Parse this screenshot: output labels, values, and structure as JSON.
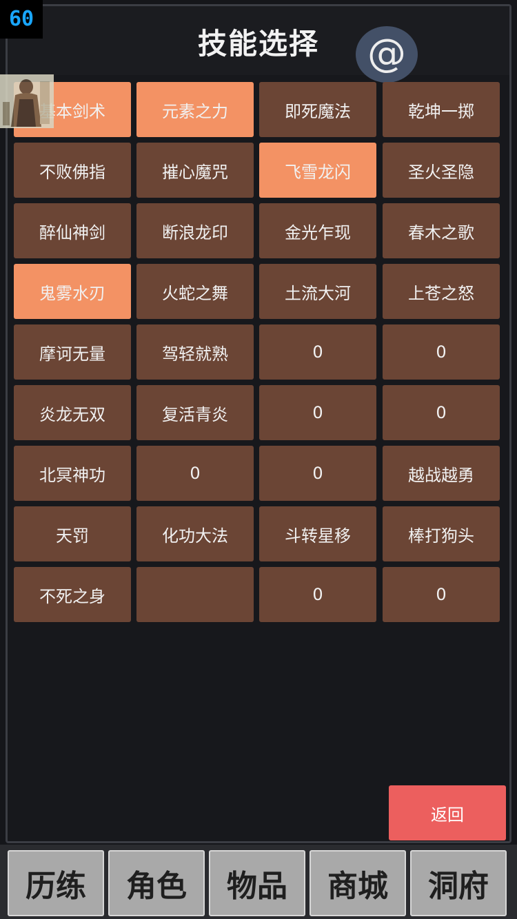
{
  "fps": "60",
  "header": {
    "title": "技能选择",
    "at_label": "@"
  },
  "skills": [
    {
      "label": "基本剑术",
      "selected": true
    },
    {
      "label": "元素之力",
      "selected": true
    },
    {
      "label": "即死魔法",
      "selected": false
    },
    {
      "label": "乾坤一掷",
      "selected": false
    },
    {
      "label": "不败佛指",
      "selected": false
    },
    {
      "label": "摧心魔咒",
      "selected": false
    },
    {
      "label": "飞雪龙闪",
      "selected": true
    },
    {
      "label": "圣火圣隐",
      "selected": false
    },
    {
      "label": "醉仙神剑",
      "selected": false
    },
    {
      "label": "断浪龙印",
      "selected": false
    },
    {
      "label": "金光乍现",
      "selected": false
    },
    {
      "label": "春木之歌",
      "selected": false
    },
    {
      "label": "鬼雾水刃",
      "selected": true
    },
    {
      "label": "火蛇之舞",
      "selected": false
    },
    {
      "label": "土流大河",
      "selected": false
    },
    {
      "label": "上苍之怒",
      "selected": false
    },
    {
      "label": "摩诃无量",
      "selected": false
    },
    {
      "label": "驾轻就熟",
      "selected": false
    },
    {
      "label": "0",
      "selected": false
    },
    {
      "label": "0",
      "selected": false
    },
    {
      "label": "炎龙无双",
      "selected": false
    },
    {
      "label": "复活青炎",
      "selected": false
    },
    {
      "label": "0",
      "selected": false
    },
    {
      "label": "0",
      "selected": false
    },
    {
      "label": "北冥神功",
      "selected": false
    },
    {
      "label": "0",
      "selected": false
    },
    {
      "label": "0",
      "selected": false
    },
    {
      "label": "越战越勇",
      "selected": false
    },
    {
      "label": "天罚",
      "selected": false
    },
    {
      "label": "化功大法",
      "selected": false
    },
    {
      "label": "斗转星移",
      "selected": false
    },
    {
      "label": "棒打狗头",
      "selected": false
    },
    {
      "label": "不死之身",
      "selected": false
    },
    {
      "label": "",
      "selected": false
    },
    {
      "label": "0",
      "selected": false
    },
    {
      "label": "0",
      "selected": false
    }
  ],
  "back_label": "返回",
  "nav": [
    {
      "label": "历练"
    },
    {
      "label": "角色"
    },
    {
      "label": "物品"
    },
    {
      "label": "商城"
    },
    {
      "label": "洞府"
    }
  ],
  "colors": {
    "cell": "#6b4535",
    "cell_selected": "#f39264",
    "back": "#ec5f5e",
    "fps": "#19a6ff"
  }
}
